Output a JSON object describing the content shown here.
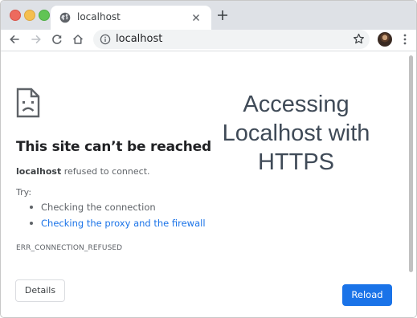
{
  "tab": {
    "title": "localhost",
    "favicon": "globe-icon",
    "close": "close-icon"
  },
  "new_tab": {
    "icon": "plus-icon"
  },
  "toolbar": {
    "back": "arrow-left-icon",
    "forward": "arrow-right-icon",
    "reload": "reload-icon",
    "home": "home-icon",
    "address": "localhost",
    "info": "info-icon",
    "bookmark": "star-icon",
    "menu": "more-vert-icon"
  },
  "error_page": {
    "icon": "sad-document-icon",
    "heading": "This site can’t be reached",
    "host": "localhost",
    "refused_text": " refused to connect.",
    "try_label": "Try:",
    "suggestions": [
      "Checking the connection",
      "Checking the proxy and the firewall"
    ],
    "error_code": "ERR_CONNECTION_REFUSED",
    "details_label": "Details",
    "reload_label": "Reload"
  },
  "overlay": {
    "lines": [
      "Accessing",
      "Localhost with",
      "HTTPS"
    ]
  },
  "colors": {
    "accent": "#1a73e8",
    "title_text": "#3f4a57",
    "tab_strip": "#dee1e6"
  }
}
